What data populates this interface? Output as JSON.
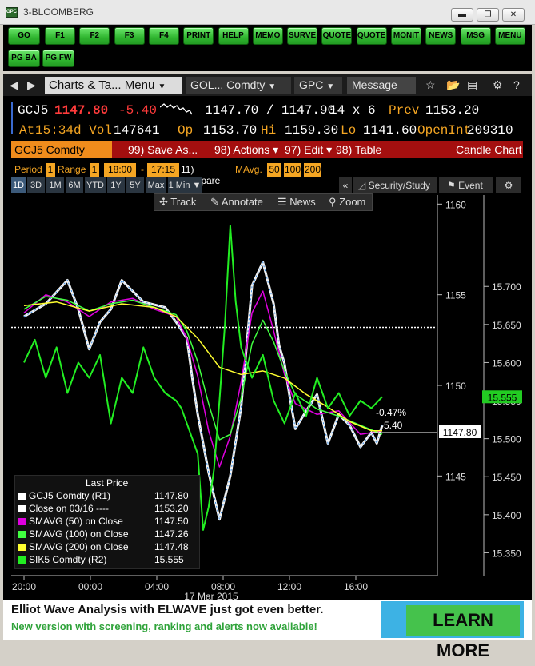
{
  "window": {
    "title": "3-BLOOMBERG",
    "icon_label": "GPC"
  },
  "buttons": {
    "row1": [
      "GO",
      "F1",
      "F2",
      "F3",
      "F4",
      "PRINT",
      "HELP",
      "MEMO",
      "SURVE",
      "QUOTE",
      "QUOTE",
      "MONIT",
      "NEWS",
      "MSG",
      "MENU"
    ],
    "row2": [
      "PG BA",
      "PG FW"
    ]
  },
  "toolbar": {
    "menu_field": "Charts & Ta... Menu",
    "security_field": "GOL... Comdty",
    "function_field": "GPC",
    "message_label": "Message"
  },
  "quote": {
    "ticker": "GCJ5",
    "last": "1147.80",
    "change": "-5.40",
    "bid_ask": "1147.70 / 1147.90",
    "size": "14 x 6",
    "prev_label": "Prev",
    "prev": "1153.20",
    "at_label": "At",
    "time": "15:34",
    "dvol_label": "d Vol",
    "dvol": "147641",
    "op_label": "Op",
    "op": "1153.70",
    "hi_label": "Hi",
    "hi": "1159.30",
    "lo_label": "Lo",
    "lo": "1141.60",
    "oi_label": "OpenInt",
    "oi": "209310"
  },
  "secbar": {
    "security": "GCJ5 Comdty",
    "save": "99) Save As...",
    "actions": "98) Actions",
    "edit": "97) Edit",
    "table": "98) Table",
    "chart_type": "Candle Chart"
  },
  "controls": {
    "period_label": "Period",
    "period_val": "1",
    "range_label": "Range",
    "range_val": "1",
    "start": "18:00",
    "dash": "-",
    "end": "17:15",
    "compare": "11) Compare",
    "mavg": "MAvg.",
    "mavg_vals": [
      "50",
      "100",
      "200"
    ]
  },
  "range_tabs": [
    "1D",
    "3D",
    "1M",
    "6M",
    "YTD",
    "1Y",
    "5Y",
    "Max",
    "1 Min ▼"
  ],
  "chart_tools": {
    "security_study": "Security/Study",
    "event": "Event",
    "track": "Track",
    "annotate": "Annotate",
    "news": "News",
    "zoom": "Zoom"
  },
  "chart_data": {
    "type": "line",
    "x_ticks": [
      "20:00",
      "00:00",
      "04:00",
      "08:00",
      "12:00",
      "16:00"
    ],
    "x_date_label": "17 Mar 2015",
    "left_axis": {
      "ticks": [
        1160,
        1155,
        1150,
        1145
      ],
      "range": [
        1139.5,
        1160.5
      ]
    },
    "right_axis": {
      "ticks": [
        15.7,
        15.65,
        15.6,
        15.55,
        15.5,
        15.45,
        15.4,
        15.35
      ],
      "tick_labels": [
        "15.700",
        "15.650",
        "15.600",
        "15.550",
        "15.500",
        "15.450",
        "15.400",
        "15.350"
      ],
      "range": [
        15.32,
        15.82
      ]
    },
    "prev_close": 1153.2,
    "last_price_label": "1147.80",
    "silver_price_label": "15.555",
    "change_pct_label": "-0.47%",
    "change_label": "-5.40",
    "series": [
      {
        "name": "GCJ5 Comdty (R1)",
        "color": "#ffffff",
        "x": [
          17,
          19,
          21,
          22,
          23,
          24,
          25,
          26,
          28,
          30,
          31,
          32,
          32.5,
          33,
          34,
          35,
          36,
          37,
          38,
          39,
          40,
          40.5,
          41,
          41.5,
          42,
          43,
          44,
          45,
          46,
          47,
          48,
          49,
          49.5,
          50
        ],
        "y": [
          1153.8,
          1154.5,
          1155.8,
          1154.2,
          1152.0,
          1153.5,
          1154.2,
          1155.8,
          1154.6,
          1154.3,
          1153.5,
          1152.6,
          1150.4,
          1148.4,
          1145.2,
          1142.6,
          1145.0,
          1148.8,
          1155.5,
          1156.8,
          1154.5,
          1152.2,
          1151.2,
          1149.3,
          1147.6,
          1148.6,
          1149.5,
          1146.8,
          1148.4,
          1147.8,
          1146.6,
          1147.4,
          1146.8,
          1147.8
        ]
      },
      {
        "name": "SMAVG (50) on Close",
        "color": "#e000e0",
        "x": [
          17,
          19,
          21,
          23,
          25,
          27,
          29,
          31,
          32,
          33,
          34,
          35,
          36,
          37,
          38,
          39,
          40,
          41,
          42,
          44,
          46,
          48,
          50
        ],
        "y": [
          1154.0,
          1155.0,
          1154.6,
          1153.8,
          1154.6,
          1154.8,
          1154.2,
          1153.8,
          1152.6,
          1150.5,
          1147.5,
          1145.5,
          1147.2,
          1150.2,
          1154.0,
          1155.2,
          1153.0,
          1150.6,
          1149.0,
          1148.4,
          1148.6,
          1147.3,
          1147.5
        ]
      },
      {
        "name": "SMAVG (100) on Close",
        "color": "#40ff40",
        "x": [
          17,
          19,
          21,
          23,
          25,
          27,
          29,
          31,
          32,
          33,
          34,
          35,
          36,
          37,
          38,
          39,
          40,
          41,
          42,
          44,
          46,
          48,
          50
        ],
        "y": [
          1154.2,
          1154.9,
          1154.7,
          1154.1,
          1154.5,
          1154.7,
          1154.3,
          1153.9,
          1153.0,
          1151.3,
          1149.0,
          1147.0,
          1147.3,
          1149.3,
          1152.3,
          1153.6,
          1152.4,
          1150.8,
          1149.5,
          1148.7,
          1148.3,
          1147.8,
          1147.3
        ]
      },
      {
        "name": "SMAVG (200) on Close",
        "color": "#ffff30",
        "x": [
          17,
          20,
          23,
          26,
          29,
          31,
          33,
          35,
          37,
          39,
          41,
          43,
          45,
          47,
          49,
          50
        ],
        "y": [
          1154.4,
          1154.6,
          1154.1,
          1154.5,
          1154.3,
          1153.8,
          1152.6,
          1151.0,
          1150.6,
          1150.8,
          1150.4,
          1149.5,
          1148.8,
          1148.0,
          1147.5,
          1147.5
        ]
      },
      {
        "name": "SIK5 Comdty (R2)",
        "color": "#22ee22",
        "axis": "right",
        "x": [
          17,
          18,
          19,
          20,
          21,
          22,
          23,
          24,
          25,
          26,
          27,
          28,
          29,
          30,
          31,
          31.5,
          32,
          32.5,
          33,
          33.5,
          34,
          34.5,
          35,
          35.5,
          36,
          36.5,
          37,
          38,
          39,
          40,
          41,
          42,
          43,
          44,
          45,
          46,
          47,
          48,
          49,
          50
        ],
        "y": [
          15.6,
          15.63,
          15.58,
          15.62,
          15.56,
          15.6,
          15.58,
          15.61,
          15.52,
          15.58,
          15.56,
          15.62,
          15.58,
          15.56,
          15.55,
          15.54,
          15.52,
          15.5,
          15.48,
          15.38,
          15.41,
          15.46,
          15.55,
          15.65,
          15.78,
          15.68,
          15.62,
          15.58,
          15.61,
          15.55,
          15.52,
          15.56,
          15.53,
          15.58,
          15.54,
          15.56,
          15.53,
          15.55,
          15.54,
          15.555
        ]
      }
    ]
  },
  "legend": {
    "title": "Last Price",
    "rows": [
      {
        "label": "GCJ5 Comdty (R1)",
        "value": "1147.80",
        "color": "#ffffff"
      },
      {
        "label": "Close on 03/16 ----",
        "value": "1153.20",
        "color": "#ffffff"
      },
      {
        "label": "SMAVG (50) on Close",
        "value": "1147.50",
        "color": "#e000e0"
      },
      {
        "label": "SMAVG (100) on Close",
        "value": "1147.26",
        "color": "#40ff40"
      },
      {
        "label": "SMAVG (200) on Close",
        "value": "1147.48",
        "color": "#ffff30"
      },
      {
        "label": "SIK5 Comdty (R2)",
        "value": "15.555",
        "color": "#22ee22"
      }
    ]
  },
  "ad": {
    "headline": "Elliot Wave Analysis with ELWAVE just got even better.",
    "subline": "New version with screening, ranking and alerts now available!",
    "cta": "LEARN MORE"
  }
}
